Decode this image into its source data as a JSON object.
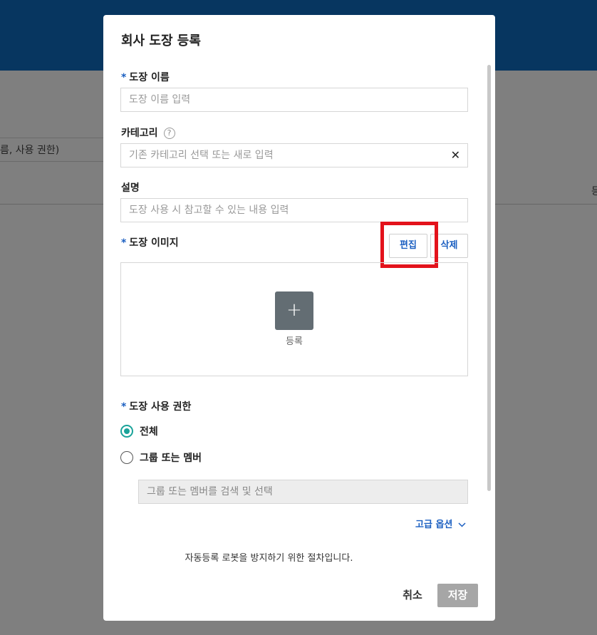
{
  "background": {
    "filter_text": "름, 사용 권한)",
    "column_header": "등"
  },
  "modal": {
    "title": "회사 도장 등록",
    "stamp_name": {
      "required_mark": "*",
      "label": "도장 이름",
      "placeholder": "도장 이름 입력"
    },
    "category": {
      "label": "카테고리",
      "help_icon": "?",
      "placeholder": "기존 카테고리 선택 또는 새로 입력",
      "clear_icon": "✕"
    },
    "description": {
      "label": "설명",
      "placeholder": "도장 사용 시 참고할 수 있는 내용 입력"
    },
    "stamp_image": {
      "required_mark": "*",
      "label": "도장 이미지",
      "edit_label": "편집",
      "delete_label": "삭제",
      "add_icon": "+",
      "add_label": "등록"
    },
    "permission": {
      "required_mark": "*",
      "label": "도장 사용 권한",
      "options": [
        {
          "label": "전체",
          "checked": true
        },
        {
          "label": "그룹 또는 멤버",
          "checked": false
        }
      ],
      "search_placeholder": "그룹 또는 멤버를 검색 및 선택"
    },
    "advanced_options": "고급 옵션",
    "recaptcha_notice": "자동등록 로봇을 방지하기 위한 절차입니다.",
    "cancel_label": "취소",
    "save_label": "저장"
  },
  "colors": {
    "header_bg": "#073660",
    "accent_blue": "#1b5fc1",
    "radio_green": "#1aa39a",
    "highlight_red": "#e3121b",
    "save_disabled": "#a6a6a6"
  }
}
